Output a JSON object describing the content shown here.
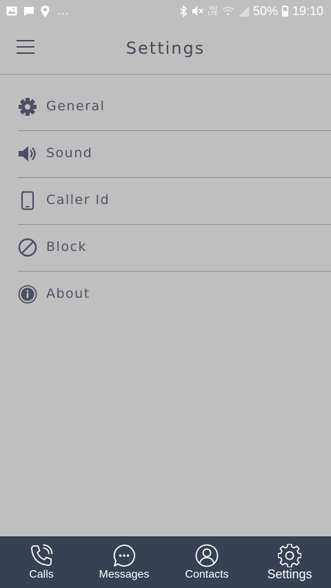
{
  "status_bar": {
    "notifications_more": "...",
    "battery_percent": "50%",
    "time": "19:10",
    "volte_label_top": "Vo)",
    "volte_label_bottom": "LTE",
    "icons": [
      "image-icon",
      "message-icon",
      "location-icon",
      "bluetooth-icon",
      "mute-icon",
      "volte-icon",
      "wifi-icon",
      "signal-icon",
      "battery-icon"
    ]
  },
  "header": {
    "title": "Settings",
    "menu_icon": "hamburger-menu-icon"
  },
  "settings": {
    "items": [
      {
        "label": "General",
        "icon": "gear-icon"
      },
      {
        "label": "Sound",
        "icon": "speaker-icon"
      },
      {
        "label": "Caller Id",
        "icon": "phone-device-icon"
      },
      {
        "label": "Block",
        "icon": "block-icon"
      },
      {
        "label": "About",
        "icon": "info-icon"
      }
    ]
  },
  "bottom_nav": {
    "tabs": [
      {
        "label": "Calls",
        "icon": "phone-icon"
      },
      {
        "label": "Messages",
        "icon": "chat-bubble-icon"
      },
      {
        "label": "Contacts",
        "icon": "person-icon"
      },
      {
        "label": "Settings",
        "icon": "gear-icon"
      }
    ],
    "active_tab": "Settings"
  },
  "colors": {
    "background": "#bfbfbf",
    "text": "#4a5060",
    "divider": "#8e8e8e",
    "nav_background": "#384054",
    "nav_text": "#ffffff"
  }
}
